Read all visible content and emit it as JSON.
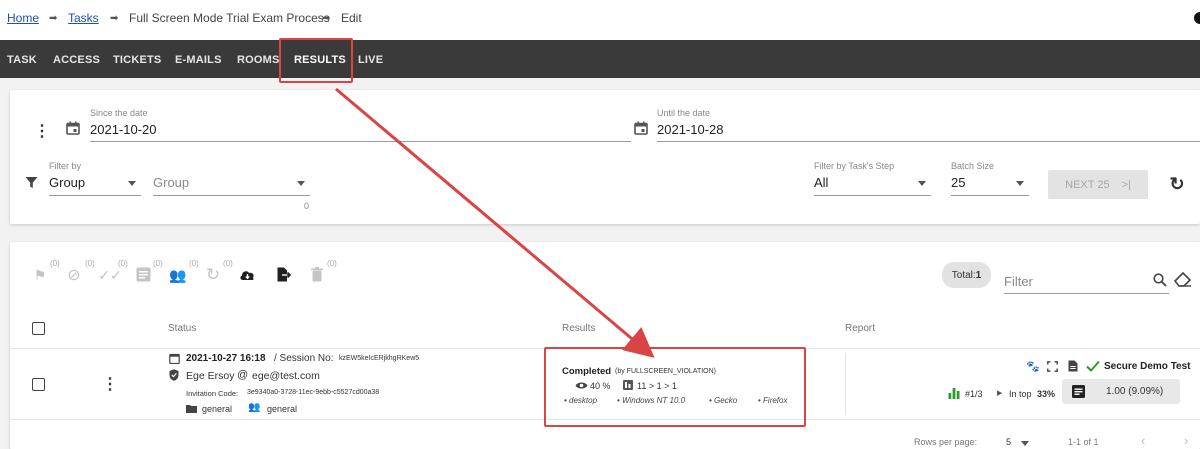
{
  "breadcrumb": {
    "home": "Home",
    "tasks": "Tasks",
    "task_name": "Full Screen Mode Trial Exam Process",
    "current": "Edit",
    "separator": "➡"
  },
  "tabs": [
    {
      "label": "TASK"
    },
    {
      "label": "ACCESS"
    },
    {
      "label": "TICKETS"
    },
    {
      "label": "E-MAILS"
    },
    {
      "label": "ROOMS"
    },
    {
      "label": "RESULTS",
      "active": true
    },
    {
      "label": "LIVE"
    }
  ],
  "filters": {
    "since_label": "Since the date",
    "since_value": "2021-10-20",
    "until_label": "Until the date",
    "until_value": "2021-10-28",
    "filter_by_label": "Filter by",
    "filter_by_value": "Group",
    "group_placeholder": "Group",
    "group_counter": "0",
    "step_label": "Filter by Task's Step",
    "step_value": "All",
    "batch_label": "Batch Size",
    "batch_value": "25",
    "next_button": "NEXT 25",
    "next_icon": ">|"
  },
  "toolbar": {
    "counts": [
      "(0)",
      "(0)",
      "(0)",
      "(0)",
      "(0)",
      "(0)"
    ],
    "total_label": "Total:",
    "total_value": "1",
    "filter_placeholder": "Filter"
  },
  "columns": {
    "status": "Status",
    "results": "Results",
    "report": "Report"
  },
  "row": {
    "datetime": "2021-10-27 16:18",
    "session_prefix": "/ Session No:",
    "session_no": "kzEW5keIcERjkhgRKew5",
    "name": "Ege Ersoy",
    "at": "@",
    "email": "ege@test.com",
    "invitation_label": "Invitation Code:",
    "invitation_code": "3e9340a0-3728-11ec-9ebb-c5527cd00a38",
    "group1": "general",
    "group2": "general",
    "result_status": "Completed",
    "result_reason": "(by FULLSCREEN_VIOLATION)",
    "view_percent": "40 %",
    "steps": "11 > 1 > 1",
    "device": "• desktop",
    "os": "• Windows NT 10.0",
    "engine": "• Gecko",
    "browser": "• Firefox",
    "report_title": "Secure Demo Test",
    "rank": "#1/3",
    "top_label": "In top",
    "top_value": "33%",
    "score": "1.00 (9.09%)"
  },
  "pagination": {
    "rows_per_page_label": "Rows per page:",
    "rows_per_page_value": "5",
    "range": "1-1 of 1"
  },
  "colors": {
    "tabbar": "#3a3a3a",
    "highlight": "#d94444",
    "check_green": "#2e9d2e",
    "link_blue": "#1f4fb3"
  }
}
